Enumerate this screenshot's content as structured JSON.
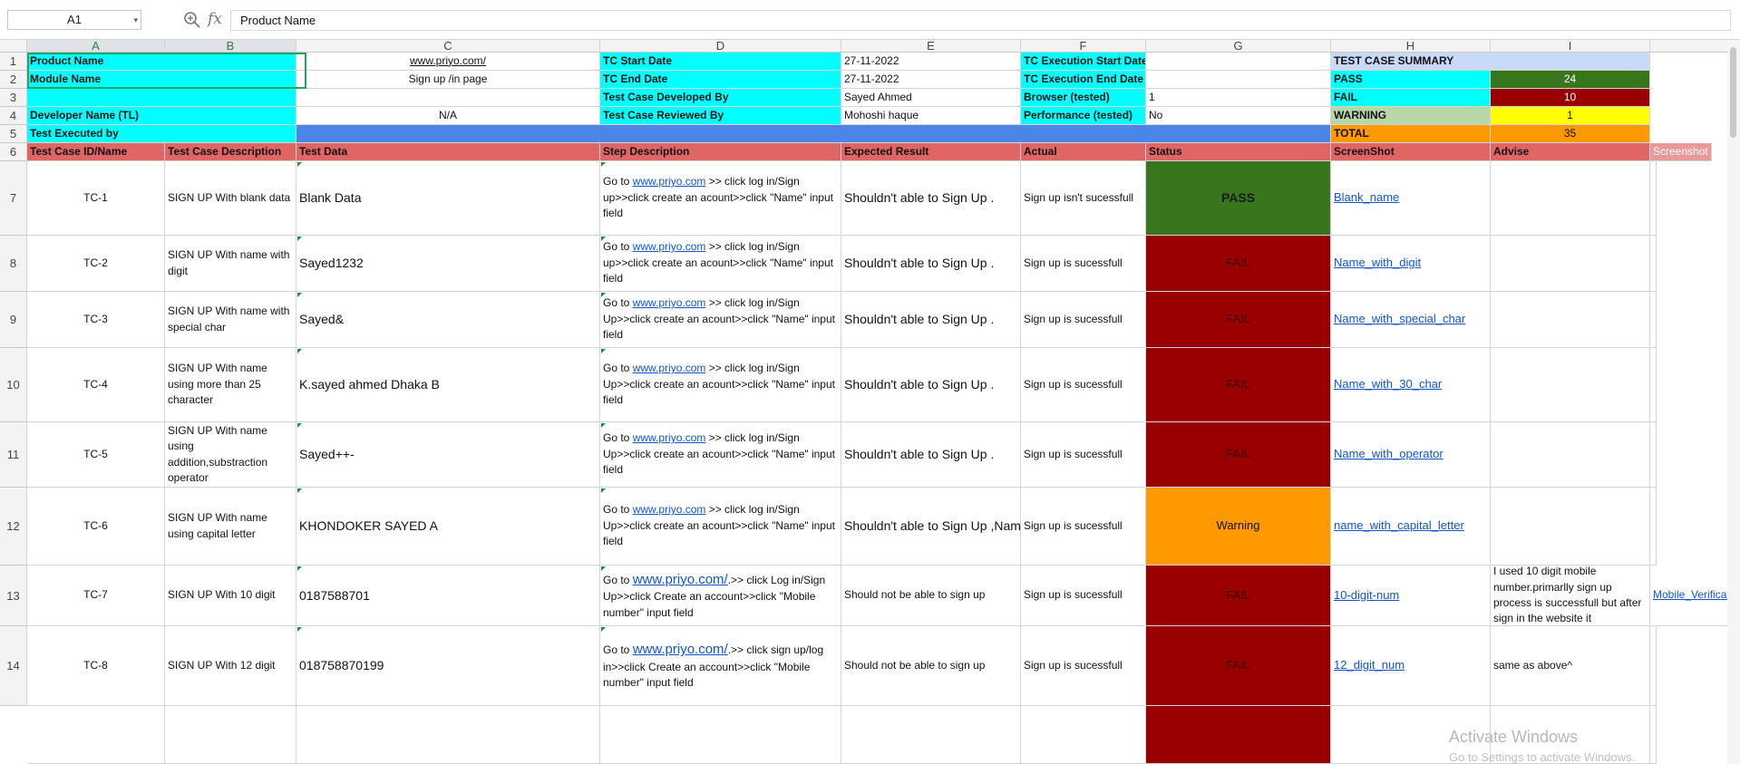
{
  "formula_bar": {
    "name_box": "A1",
    "formula": "Product Name"
  },
  "columns": [
    "A",
    "B",
    "C",
    "D",
    "E",
    "F",
    "G",
    "H",
    "I",
    "J"
  ],
  "rows": [
    "1",
    "2",
    "3",
    "4",
    "5",
    "6",
    "7",
    "8",
    "9",
    "10",
    "11",
    "12",
    "13",
    "14"
  ],
  "header_block": {
    "product_name_label": "Product Name",
    "product_url": "www.priyo.com/",
    "tc_start_date_label": "TC Start Date",
    "tc_start_date": "27-11-2022",
    "tc_exec_start_label": "TC Execution Start Date",
    "summary_title": "TEST CASE SUMMARY",
    "module_name_label": "Module Name",
    "module_name": "Sign up /in page",
    "tc_end_date_label": "TC End Date",
    "tc_end_date": "27-11-2022",
    "tc_exec_end_label": "TC Execution End Date",
    "developed_by_label": "Test Case Developed By",
    "developed_by": "Sayed Ahmed",
    "browser_label": "Browser (tested)",
    "browser_value": "1",
    "developer_name_label": "Developer Name (TL)",
    "developer_name": "N/A",
    "reviewed_by_label": "Test Case Reviewed By",
    "reviewed_by": "Mohoshi haque",
    "performance_label": "Performance (tested)",
    "performance_value": "No",
    "executed_by_label": "Test Executed by"
  },
  "summary": {
    "pass_label": "PASS",
    "pass_count": "24",
    "fail_label": "FAIL",
    "fail_count": "10",
    "warning_label": "WARNING",
    "warning_count": "1",
    "total_label": "TOTAL",
    "total_count": "35"
  },
  "table_headers": [
    "Test Case ID/Name",
    "Test Case Description",
    "Test Data",
    "Step Description",
    "Expected Result",
    "Actual",
    "Status",
    "ScreenShot",
    "Advise",
    "Screenshot"
  ],
  "test_cases": [
    {
      "id": "TC-1",
      "desc": "SIGN UP With blank data",
      "data": "Blank Data",
      "step_pre": "Go to ",
      "step_link": "www.priyo.com",
      "step_post": " >> click log in/Sign up>>click create an acount>>click \"Name\" input field",
      "expected": "Shouldn't able to Sign Up .",
      "actual": "Sign up isn't sucessfull",
      "status": "PASS",
      "shot": "Blank_name",
      "advise": "",
      "shot2": ""
    },
    {
      "id": "TC-2",
      "desc": "SIGN UP With  name with digit",
      "data": "Sayed1232",
      "step_pre": "Go to ",
      "step_link": "www.priyo.com",
      "step_post": " >> click log in/Sign up>>click create an acount>>click \"Name\" input field",
      "expected": "Shouldn't able to Sign Up .",
      "actual": "Sign up is sucessfull",
      "status": "FAIL",
      "shot": "Name_with_digit",
      "advise": "",
      "shot2": ""
    },
    {
      "id": "TC-3",
      "desc": "SIGN UP With  name with special char",
      "data": "Sayed&",
      "step_pre": "Go to ",
      "step_link": "www.priyo.com",
      "step_post": " >> click log in/Sign Up>>click create an acount>>click \"Name\" input field",
      "expected": "Shouldn't able to Sign Up .",
      "actual": "Sign up is sucessfull",
      "status": "FAIL",
      "shot": "Name_with_special_char",
      "advise": "",
      "shot2": ""
    },
    {
      "id": "TC-4",
      "desc": "SIGN UP With  name using more than 25 character",
      "data": "K.sayed ahmed Dhaka B",
      "step_pre": "Go to ",
      "step_link": "www.priyo.com",
      "step_post": " >> click log in/Sign Up>>click create an acount>>click \"Name\" input field",
      "expected": "Shouldn't able to Sign Up .",
      "actual": "Sign up is sucessfull",
      "status": "FAIL",
      "shot": "Name_with_30_char",
      "advise": "",
      "shot2": ""
    },
    {
      "id": "TC-5",
      "desc": "SIGN UP With  name using addition,substraction operator",
      "data": "Sayed++-",
      "step_pre": "Go to ",
      "step_link": "www.priyo.com",
      "step_post": " >> click log in/Sign Up>>click create an acount>>click \"Name\" input field",
      "expected": "Shouldn't able to Sign Up .",
      "actual": "Sign up is sucessfull",
      "status": "FAIL",
      "shot": "Name_with_operator",
      "advise": "",
      "shot2": ""
    },
    {
      "id": "TC-6",
      "desc": "SIGN UP With  name using capital letter",
      "data": "KHONDOKER SAYED A",
      "step_pre": "Go to ",
      "step_link": "www.priyo.com",
      "step_post": " >> click log in/Sign Up>>click create an acount>>click \"Name\" input field",
      "expected": "Shouldn't able to Sign Up ,Name Should be m",
      "actual": "Sign up is sucessfull",
      "status": "Warning",
      "shot": "name_with_capital_letter",
      "advise": "",
      "shot2": ""
    },
    {
      "id": "TC-7",
      "desc": "SIGN UP With 10 digit",
      "data": "0187588701",
      "step_pre": "Go to ",
      "step_link": "www.priyo.com/",
      "step_post": ".>> click Log in/Sign Up>>click Create an account>>click \"Mobile number\" input field",
      "expected": "Should not be able to sign up",
      "actual": "Sign up is sucessfull",
      "status": "FAIL",
      "shot": "10-digit-num",
      "advise": "I used 10 digit mobile number.primarlly sign up process is successfull but after sign in the website it",
      "shot2": "Mobile_Verification"
    },
    {
      "id": "TC-8",
      "desc": "SIGN UP With 12 digit",
      "data": "018758870199",
      "step_pre": "Go to ",
      "step_link": "www.priyo.com/",
      "step_post": ".>> click sign up/log in>>click Create an account>>click \"Mobile number\" input field",
      "expected": "Should not be able to sign up",
      "actual": "Sign up is sucessfull",
      "status": "FAIL",
      "shot": "12_digit_num",
      "advise": " same as above^",
      "shot2": ""
    }
  ],
  "colors": {
    "cyan": "#00ffff",
    "header_red": "#e06666",
    "blue": "#4a86e8",
    "pass_green": "#38761d",
    "fail_red": "#990000",
    "warning_orange": "#ff9900",
    "summary_blue": "#c9daf8",
    "yellow": "#ffff00",
    "total_orange": "#ff9900",
    "warning_label_green": "#b6d7a8"
  },
  "watermark": {
    "line1": "Activate Windows",
    "line2": "Go to Settings to activate Windows."
  }
}
